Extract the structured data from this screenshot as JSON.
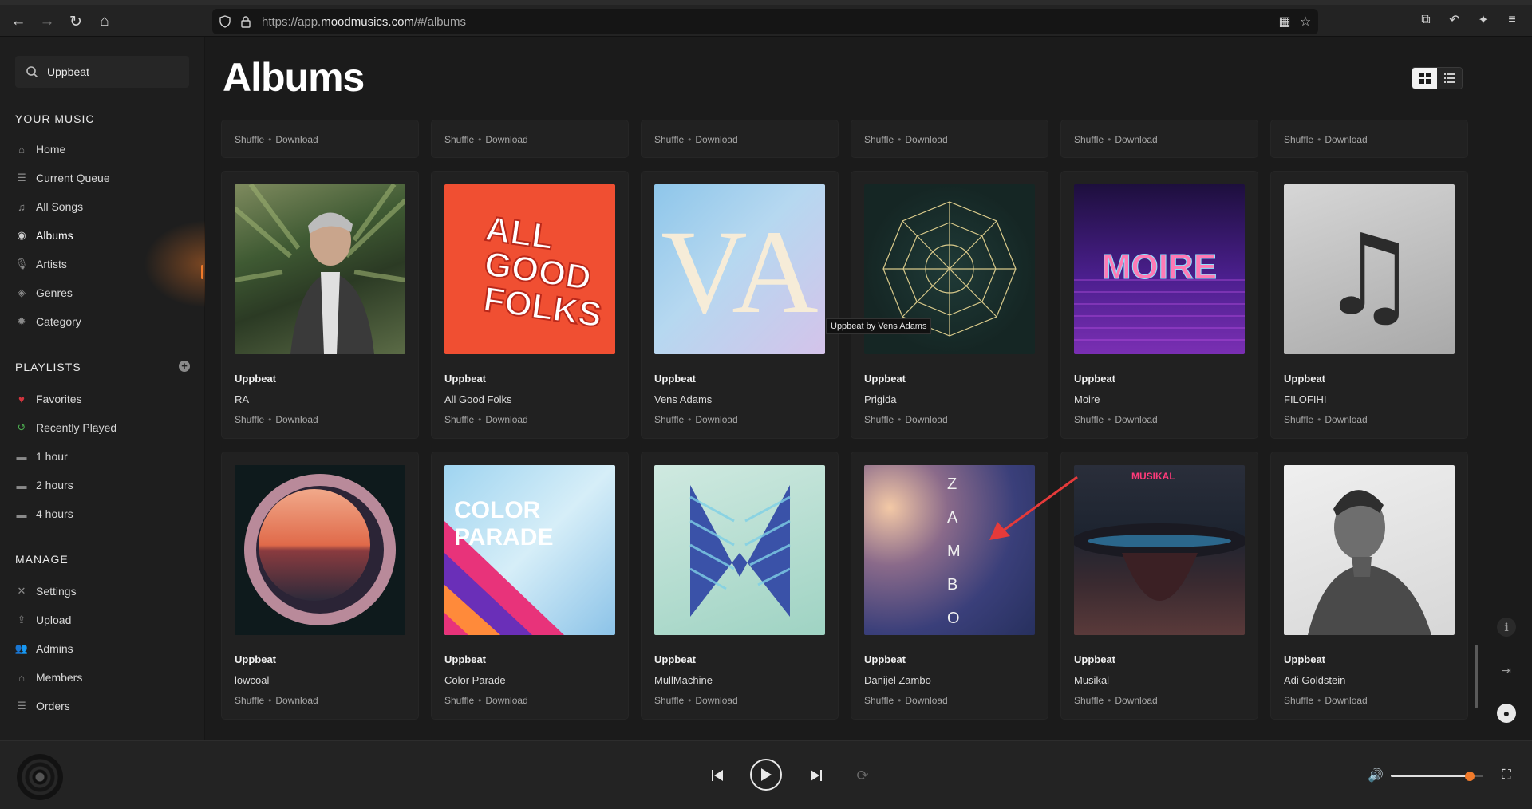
{
  "browser": {
    "url_prefix": "https://app.",
    "url_domain": "moodmusics.com",
    "url_path": "/#/albums"
  },
  "sidebar": {
    "search_value": "Uppbeat",
    "your_music_title": "YOUR MUSIC",
    "your_music": [
      {
        "label": "Home",
        "icon": "home-icon"
      },
      {
        "label": "Current Queue",
        "icon": "queue-icon"
      },
      {
        "label": "All Songs",
        "icon": "music-note-icon"
      },
      {
        "label": "Albums",
        "icon": "disc-icon"
      },
      {
        "label": "Artists",
        "icon": "microphone-icon"
      },
      {
        "label": "Genres",
        "icon": "tags-icon"
      },
      {
        "label": "Category",
        "icon": "gear-icon"
      }
    ],
    "playlists_title": "PLAYLISTS",
    "playlists": [
      {
        "label": "Favorites",
        "icon": "heart-icon"
      },
      {
        "label": "Recently Played",
        "icon": "history-icon"
      },
      {
        "label": "1 hour",
        "icon": "folder-icon"
      },
      {
        "label": "2 hours",
        "icon": "folder-icon"
      },
      {
        "label": "4 hours",
        "icon": "folder-icon"
      }
    ],
    "manage_title": "MANAGE",
    "manage": [
      {
        "label": "Settings",
        "icon": "tools-icon"
      },
      {
        "label": "Upload",
        "icon": "upload-icon"
      },
      {
        "label": "Admins",
        "icon": "users-icon"
      },
      {
        "label": "Members",
        "icon": "members-icon"
      },
      {
        "label": "Orders",
        "icon": "list-icon"
      }
    ],
    "accent_color": "#f07a2a"
  },
  "main": {
    "title": "Albums",
    "actions": {
      "shuffle": "Shuffle",
      "separator": "•",
      "download": "Download"
    },
    "tooltip": "Uppbeat by Vens Adams",
    "albums": [
      {
        "artist": "Uppbeat",
        "name": "RA"
      },
      {
        "artist": "Uppbeat",
        "name": "All Good Folks",
        "cover_text": [
          "ALL",
          "GOOD",
          "FOLKS"
        ]
      },
      {
        "artist": "Uppbeat",
        "name": "Vens Adams",
        "cover_text": "VA"
      },
      {
        "artist": "Uppbeat",
        "name": "Prigida"
      },
      {
        "artist": "Uppbeat",
        "name": "Moire",
        "cover_text": "MOIRE"
      },
      {
        "artist": "Uppbeat",
        "name": "FILOFIHI",
        "cover_text": "♫"
      },
      {
        "artist": "Uppbeat",
        "name": "lowcoal"
      },
      {
        "artist": "Uppbeat",
        "name": "Color Parade",
        "cover_text": [
          "COLOR",
          "PARADE"
        ]
      },
      {
        "artist": "Uppbeat",
        "name": "MullMachine"
      },
      {
        "artist": "Uppbeat",
        "name": "Danijel Zambo",
        "cover_text": [
          "Z",
          "A",
          "M",
          "B",
          "O"
        ]
      },
      {
        "artist": "Uppbeat",
        "name": "Musikal",
        "cover_text": "MUSIKAL"
      },
      {
        "artist": "Uppbeat",
        "name": "Adi Goldstein"
      }
    ]
  },
  "player": {
    "volume": 0.85
  }
}
